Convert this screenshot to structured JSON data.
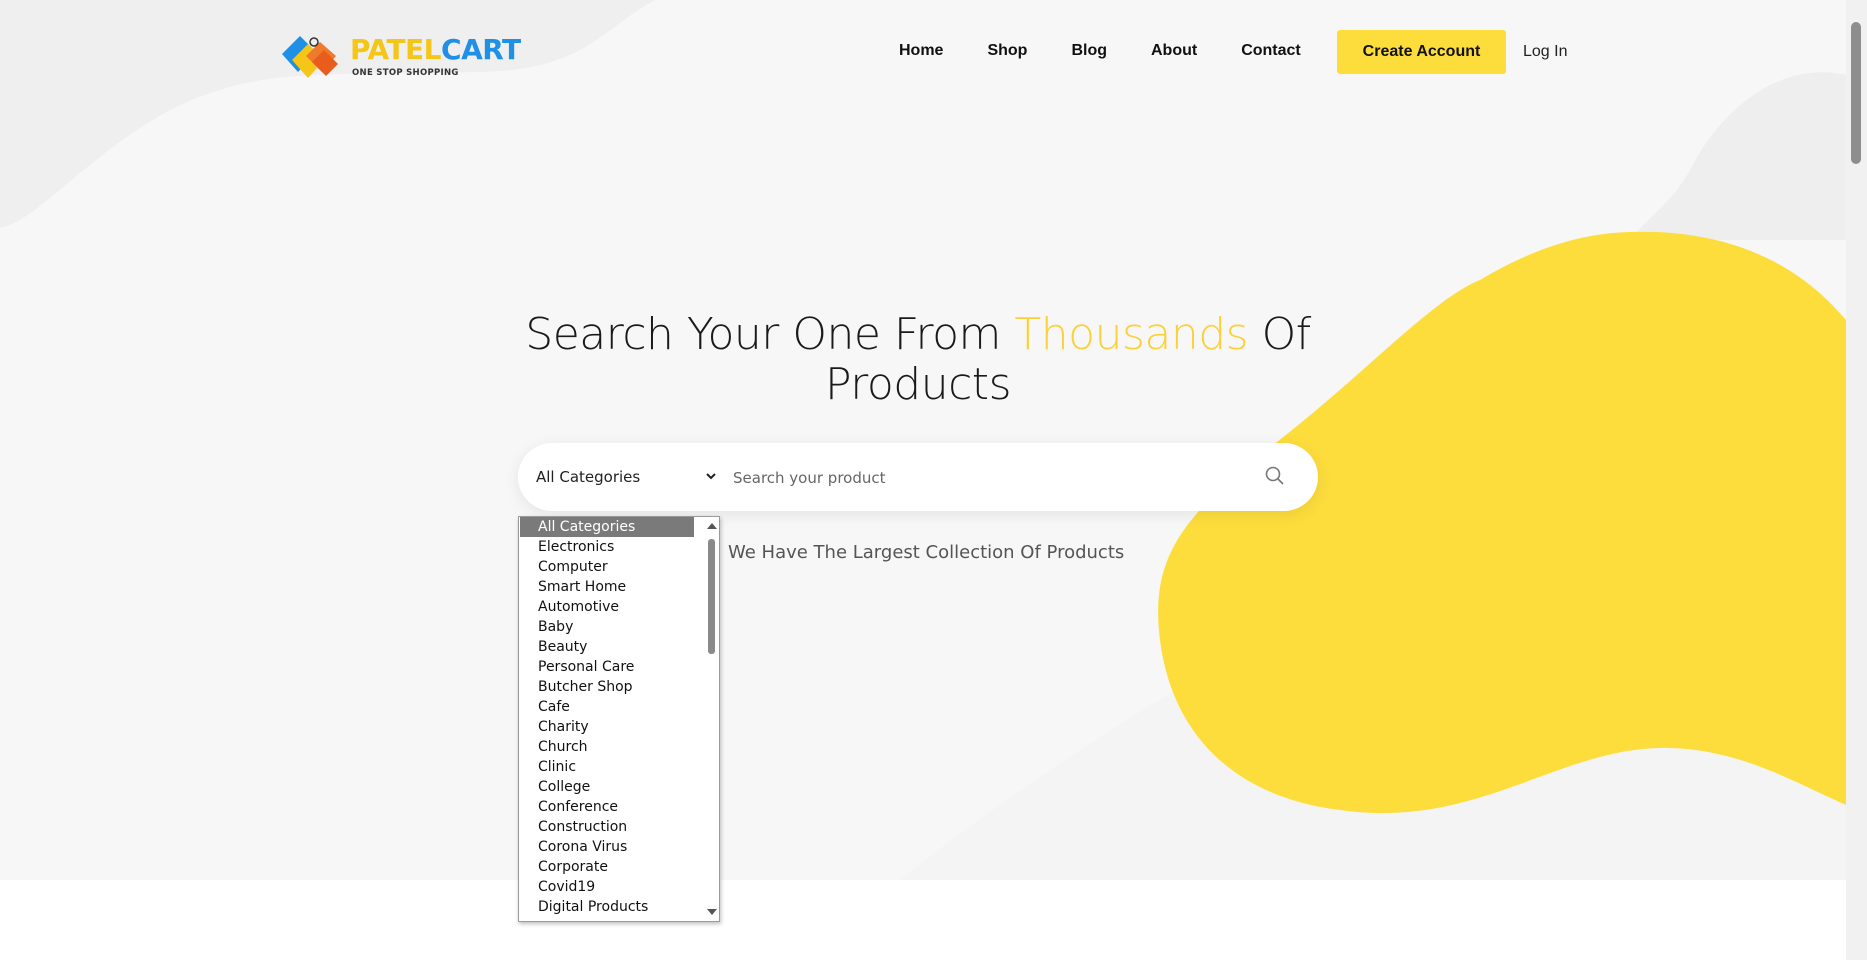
{
  "logo": {
    "part1": "PATEL",
    "part2": "CART",
    "tagline": "ONE STOP SHOPPING"
  },
  "nav": {
    "items": [
      {
        "label": "Home"
      },
      {
        "label": "Shop"
      },
      {
        "label": "Blog"
      },
      {
        "label": "About"
      },
      {
        "label": "Contact"
      }
    ],
    "create_account": "Create Account",
    "login": "Log In"
  },
  "hero": {
    "headline_pre": "Search Your One From ",
    "headline_highlight": "Thousands",
    "headline_post": " Of Products",
    "subtitle": "We Have The Largest Collection Of Products"
  },
  "search": {
    "category_value": "All Categories",
    "placeholder": "Search your product"
  },
  "dropdown": {
    "selected": "All Categories",
    "options": [
      "All Categories",
      "Electronics",
      "Computer",
      "Smart Home",
      "Automotive",
      "Baby",
      "Beauty",
      "Personal Care",
      "Butcher Shop",
      "Cafe",
      "Charity",
      "Church",
      "Clinic",
      "College",
      "Conference",
      "Construction",
      "Corona Virus",
      "Corporate",
      "Covid19",
      "Digital Products"
    ]
  },
  "colors": {
    "accent": "#fddd3c",
    "logo_blue": "#1e90e6",
    "logo_yellow": "#f5c518"
  },
  "icons": {
    "search": "search-icon",
    "chevron": "chevron-down-icon"
  }
}
